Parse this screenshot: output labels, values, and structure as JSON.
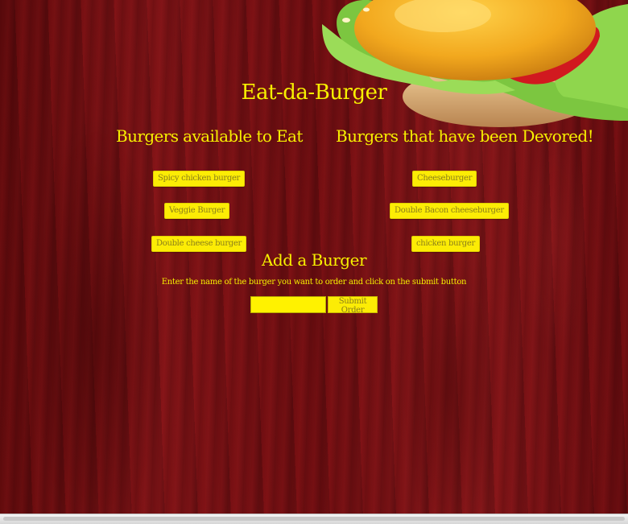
{
  "header": {
    "title": "Eat-da-Burger"
  },
  "available": {
    "title": "Burgers available to Eat",
    "items": [
      "Spicy chicken burger",
      "Veggie Burger",
      "Double cheese burger"
    ]
  },
  "devoured": {
    "title": "Burgers that have been Devored!",
    "items": [
      "Cheeseburger",
      "Double Bacon cheeseburger",
      "chicken burger"
    ]
  },
  "add_form": {
    "title": "Add a Burger",
    "instructions": "Enter the name of the burger you want to order and click on the submit button",
    "input_value": "",
    "submit_label": "Submit Order"
  },
  "colors": {
    "accent": "#f7f000",
    "button": "#fcec05",
    "background": "#6e0e11"
  }
}
